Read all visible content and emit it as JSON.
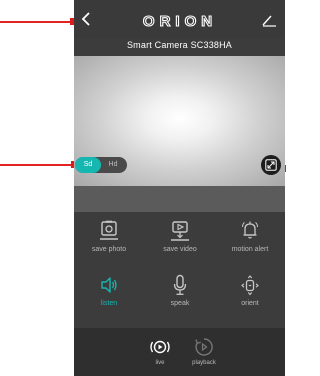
{
  "header": {
    "brand": "ORION"
  },
  "camera": {
    "name": "Smart Camera SC338HA"
  },
  "quality": {
    "options": [
      "Sd",
      "Hd"
    ],
    "selected": "Sd"
  },
  "controls": [
    {
      "label": "save photo",
      "icon": "camera-icon"
    },
    {
      "label": "save video",
      "icon": "download-video-icon"
    },
    {
      "label": "motion alert",
      "icon": "bell-icon"
    },
    {
      "label": "listen",
      "icon": "speaker-icon",
      "active": true
    },
    {
      "label": "speak",
      "icon": "microphone-icon"
    },
    {
      "label": "orient",
      "icon": "orient-icon"
    }
  ],
  "bottom_tabs": [
    {
      "label": "live",
      "icon": "live-icon"
    },
    {
      "label": "playback",
      "icon": "playback-icon"
    }
  ],
  "colors": {
    "accent": "#17b7b1",
    "background": "#3c3c3c",
    "annotation": "#e32222"
  }
}
